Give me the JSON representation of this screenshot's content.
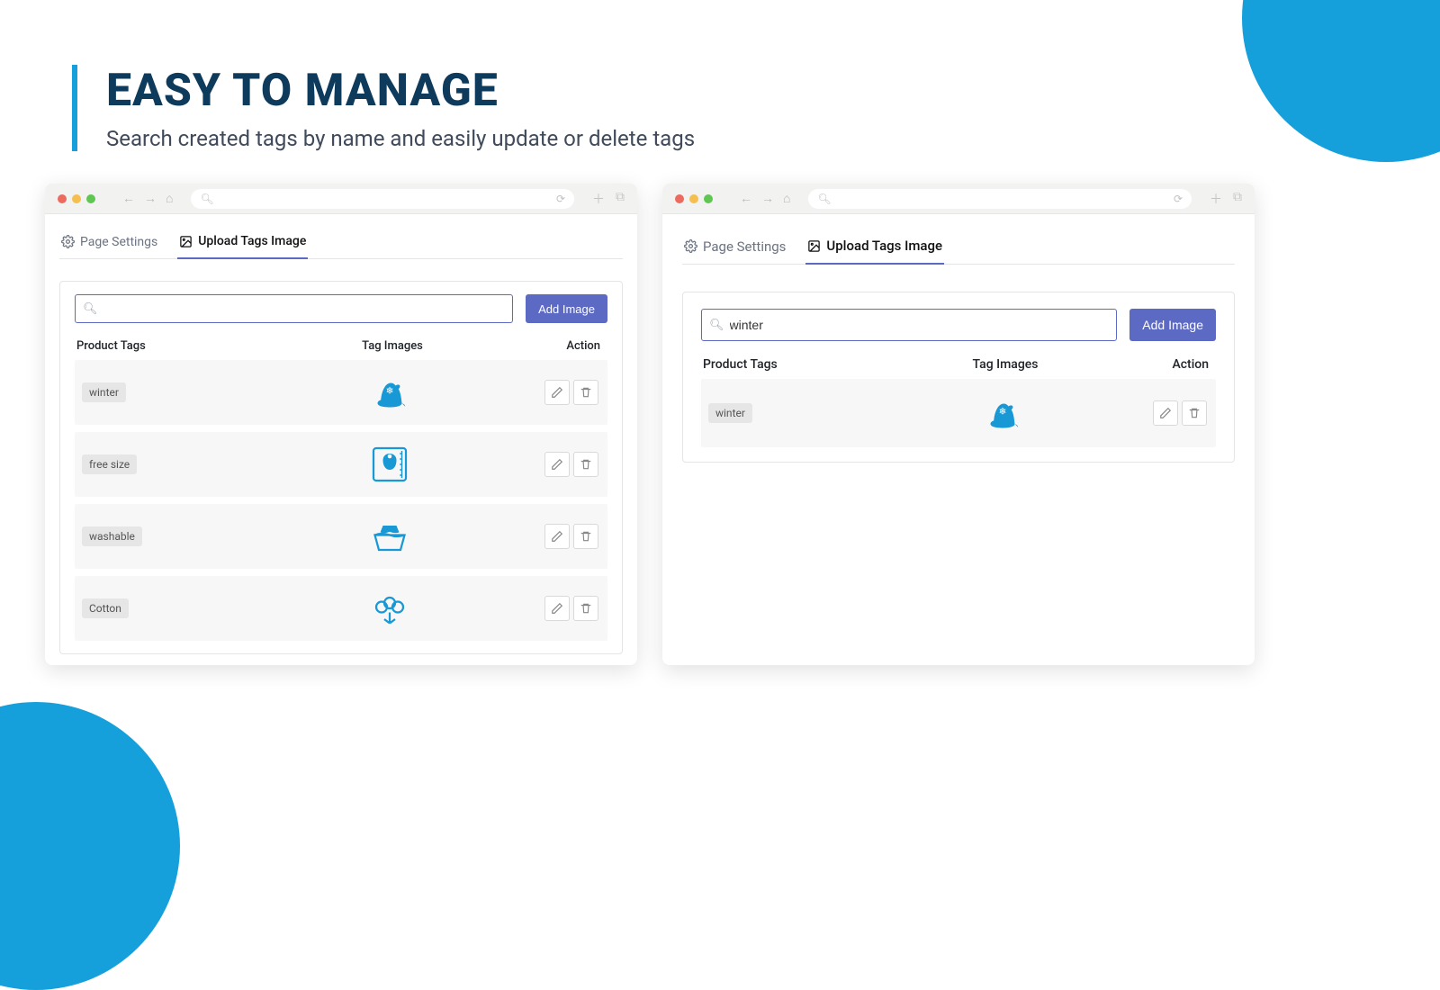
{
  "header": {
    "title": "EASY TO MANAGE",
    "subtitle": "Search created tags by name and easily update or delete tags"
  },
  "tabs": {
    "settings": "Page Settings",
    "upload": "Upload Tags Image"
  },
  "columns": {
    "tags": "Product Tags",
    "images": "Tag Images",
    "action": "Action"
  },
  "toolbar": {
    "add_label": "Add Image",
    "search_left": "",
    "search_right": "winter"
  },
  "rows_left": [
    {
      "tag": "winter",
      "icon": "hat"
    },
    {
      "tag": "free size",
      "icon": "size"
    },
    {
      "tag": "washable",
      "icon": "wash"
    },
    {
      "tag": "Cotton",
      "icon": "cotton"
    }
  ],
  "rows_right": [
    {
      "tag": "winter",
      "icon": "hat"
    }
  ]
}
